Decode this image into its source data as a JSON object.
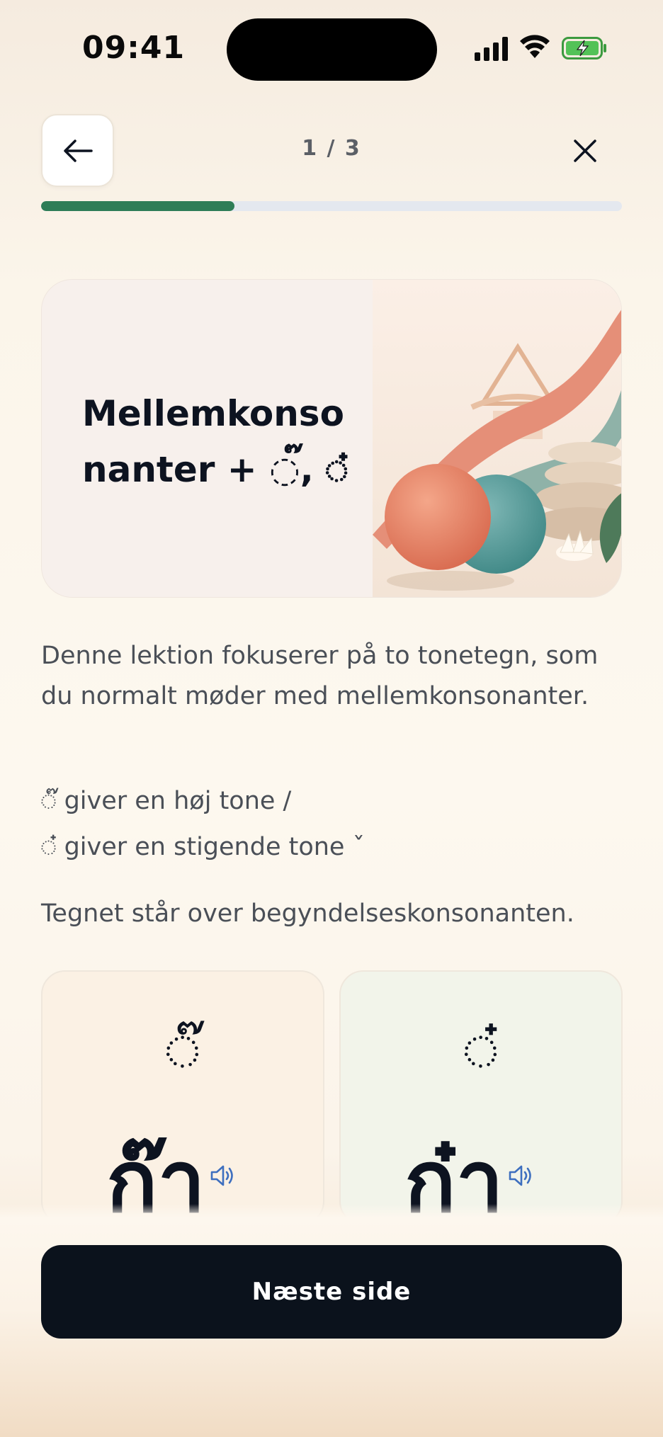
{
  "status_bar": {
    "time": "09:41"
  },
  "header": {
    "page_counter": "1 / 3",
    "progress_fraction": 0.333,
    "progress_color": "#2e7d57"
  },
  "hero": {
    "title": "Mellemkonsonanter + ◌๊, ◌๋"
  },
  "body": {
    "intro": "Denne lektion fokuserer på to tonetegn, som du normalt møder med mellemkonsonanter.",
    "mark_line_1": "◌๊ giver en høj tone /",
    "mark_line_2": "◌๋ giver en stigende tone ˇ",
    "position_note": "Tegnet står over begyndelseskonsonanten."
  },
  "cards": [
    {
      "mark": "◌๊",
      "syllable": "ก๊า",
      "background": "#fbf1e4"
    },
    {
      "mark": "◌๋",
      "syllable": "ก๋า",
      "background": "#f2f4ea"
    }
  ],
  "footer": {
    "next_label": "Næste side"
  },
  "icons": [
    "back-arrow-icon",
    "close-icon",
    "speaker-icon",
    "signal-icon",
    "wifi-icon",
    "battery-charging-icon"
  ]
}
